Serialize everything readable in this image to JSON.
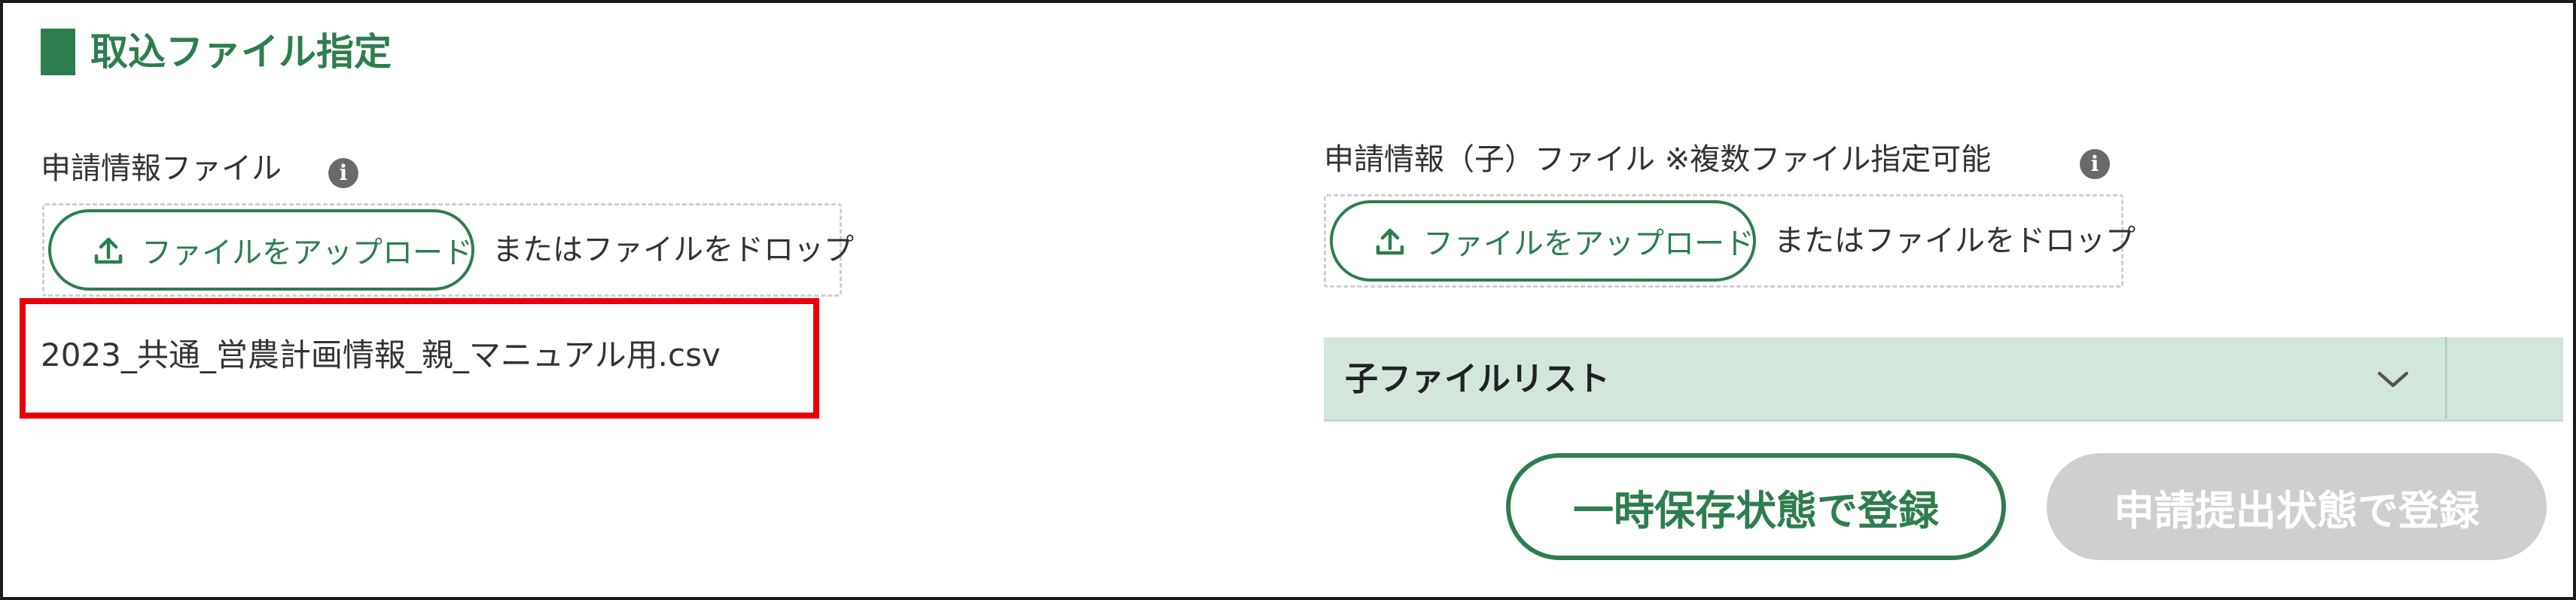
{
  "section": {
    "title": "取込ファイル指定"
  },
  "application_file": {
    "label": "申請情報ファイル",
    "info_icon": "info-icon",
    "upload_label": "ファイルをアップロード",
    "drop_text": "またはファイルをドロップ",
    "selected_file": "2023_共通_営農計画情報_親_マニュアル用.csv"
  },
  "child_file": {
    "label": "申請情報（子）ファイル ※複数ファイル指定可能",
    "info_icon": "info-icon",
    "upload_label": "ファイルをアップロード",
    "drop_text": "またはファイルをドロップ",
    "list_title": "子ファイルリスト",
    "list_expanded": false
  },
  "actions": {
    "save_temp_label": "一時保存状態で登録",
    "submit_label": "申請提出状態で登録",
    "submit_enabled": false
  },
  "colors": {
    "accent": "#2e7d4f",
    "highlight_border": "#e8000a",
    "list_header_bg": "#d3e6dc",
    "disabled_button_bg": "#cfcfcf"
  }
}
